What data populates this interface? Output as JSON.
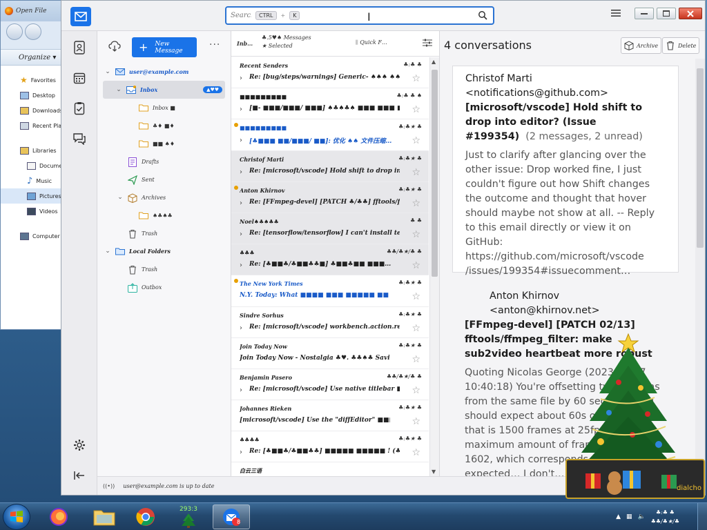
{
  "explorer": {
    "title": "Open File",
    "organize_label": "Organize ▾",
    "items": [
      "Favorites",
      "Desktop",
      "Downloads",
      "Recent Places",
      "Libraries",
      "Documents",
      "Music",
      "Pictures",
      "Videos",
      "Computer"
    ]
  },
  "app": {
    "search": {
      "placeholder": "Search…",
      "shortcut_mod": "CTRL",
      "shortcut_key": "K"
    }
  },
  "folder_pane": {
    "new_message_label": "New Message",
    "account": "user@example.com",
    "folders": [
      {
        "label": "Inbox",
        "badge": "▲♥♥"
      },
      {
        "label": "Inbox ■"
      },
      {
        "label": "♣♦ ■♦"
      },
      {
        "label": "■■ ♠♦"
      },
      {
        "label": "Drafts"
      },
      {
        "label": "Sent"
      },
      {
        "label": "Archives"
      },
      {
        "label": "♠♣♠♣"
      },
      {
        "label": "Trash"
      },
      {
        "label": "Local Folders"
      },
      {
        "label": "Trash"
      },
      {
        "label": "Outbox"
      }
    ]
  },
  "list": {
    "header_left": "Inb…",
    "selection": "♣.5♥♠ Messages",
    "selection_sub": "★ Selected",
    "quick_filter": "Quick F…",
    "rows": [
      {
        "from": "Recent Senders",
        "date": "♣:♣ ♣",
        "subject": "Re: [bug/steps/warnings] Generic- ♠♠♠ ♠♠…",
        "thread": true,
        "shade": false,
        "unread": false,
        "dot": false
      },
      {
        "from": "■■■■■■■■■",
        "date": "♣:♣ ♣ ♠",
        "subject": "[■- ■■■/■■■/ ■■■] ♠♣♠♣♠ ■■■ ■■■ ■■■…",
        "thread": true,
        "shade": false,
        "unread": false,
        "dot": false
      },
      {
        "from": "■■■■■■■■■",
        "date": "♣:♣★ ♣",
        "subject": "[♣■■■ ■■/■■■/ ■■]: 优化 ♠♠ 文件压缩…",
        "thread": true,
        "shade": false,
        "unread": true,
        "dot": true
      },
      {
        "from": "Christof Marti",
        "date": "♣:♣★ ♣",
        "subject": "Re: [microsoft/vscode] Hold shift to drop into editor? (…",
        "thread": true,
        "shade": true,
        "unread": false,
        "dot": false
      },
      {
        "from": "Anton Khirnov",
        "date": "♣:♣★ ♣",
        "subject": "Re: [FFmpeg-devel] [PATCH ♣/♣♣] fftools/ffm…",
        "thread": true,
        "shade": true,
        "unread": false,
        "dot": true
      },
      {
        "from": "Noel♠♣♠♣♣",
        "date": "♣ ♣",
        "subject": "Re: [tensorflow/tensorflow] I can't install tensorflow on …",
        "thread": true,
        "shade": true,
        "unread": false,
        "dot": false
      },
      {
        "from": "♣♣♣",
        "date": "♣♣/♣★/♣ ♣",
        "subject": "Re: [♣■■♣/♣■■♣♣■] ♣■■♣■■ ■■■…",
        "thread": true,
        "shade": true,
        "unread": false,
        "dot": false
      },
      {
        "from": "The New York Times",
        "date": "♣:♣★ ♣",
        "subject": "N.Y. Today: What ■■■■ ■■■ ■■■■■ ■■ ■■■■■",
        "thread": false,
        "shade": false,
        "unread": true,
        "dot": true
      },
      {
        "from": "Sindre Sorhus",
        "date": "♣:♣★ ♣",
        "subject": "Re: [microsoft/vscode] workbench.action.reopen[…",
        "thread": true,
        "shade": false,
        "unread": false,
        "dot": false
      },
      {
        "from": "Join Today Now",
        "date": "♣:♣★ ♣",
        "subject": "Join Today Now - Nostalgia ♣♥. ♣♣♠♣ Saving…",
        "thread": false,
        "shade": false,
        "unread": false,
        "dot": false
      },
      {
        "from": "Benjamin Pasero",
        "date": "♣♣/♣★/♣ ♣",
        "subject": "Re: [microsoft/vscode] Use native titlebar ■■■ ■■■…",
        "thread": true,
        "shade": false,
        "unread": false,
        "dot": false
      },
      {
        "from": "Johannes Rieken",
        "date": "♣:♣★ ♣",
        "subject": "[microsoft/vscode] Use the \"diffEditor\" ■■■■ ■■■ ■■■…",
        "thread": false,
        "shade": false,
        "unread": false,
        "dot": false
      },
      {
        "from": "♣♣♣♣",
        "date": "♣:♣★ ♣",
        "subject": "Re: [♣■■♣/♣■■♣♣] ■■■■■ ■■■■■ ! (♣♣♣♣ …",
        "thread": true,
        "shade": false,
        "unread": false,
        "dot": false
      },
      {
        "from": "白云三语",
        "date": "",
        "subject": "",
        "thread": false,
        "shade": false,
        "unread": false,
        "dot": false
      }
    ]
  },
  "status": {
    "text": "user@example.com is up to date"
  },
  "reader": {
    "title": "4 conversations",
    "archive_label": "Archive",
    "delete_label": "Delete",
    "conversations": [
      {
        "from": "Christof Marti <notifications@github.com>",
        "subject": "[microsoft/vscode] Hold shift to drop into editor? (Issue #199354)",
        "count": "(2 messages, 2 unread)",
        "preview": "Just to clarify after glancing over the other issue: Drop worked fine, I just couldn't figure out how Shift changes the outcome and thought that hover should maybe not show at all. -- Reply to this email directly or view it on GitHub: https://github.com/microsoft/vscode /issues/199354#issuecomment…"
      },
      {
        "from": "Anton Khirnov <anton@khirnov.net>",
        "subject": "[FFmpeg-devel] [PATCH 02/13] fftools/ffmpeg_filter: make sub2video heartbeat more robust",
        "count": "",
        "preview": "Quoting Nicolas George (2023-11-27 10:40:18) You're offsetting two streams from the same file by 60 seconds, you should expect about 60s of buffering, that is 1500 frames at 25fps. The maximum amount of frames buffered is 1602, which corresponds to the expected… I don't…"
      }
    ]
  },
  "gadget": {
    "caption": "dialcho"
  },
  "taskbar": {
    "tray_counter": "293:3",
    "mail_badge": "8",
    "clock_time": "♣:♣ ♣",
    "clock_date": "♣♣/♣★/♣"
  },
  "colors": {
    "accent": "#1a73e8",
    "unread_blue": "#1a5bc8",
    "taskbar": "#24496f"
  }
}
